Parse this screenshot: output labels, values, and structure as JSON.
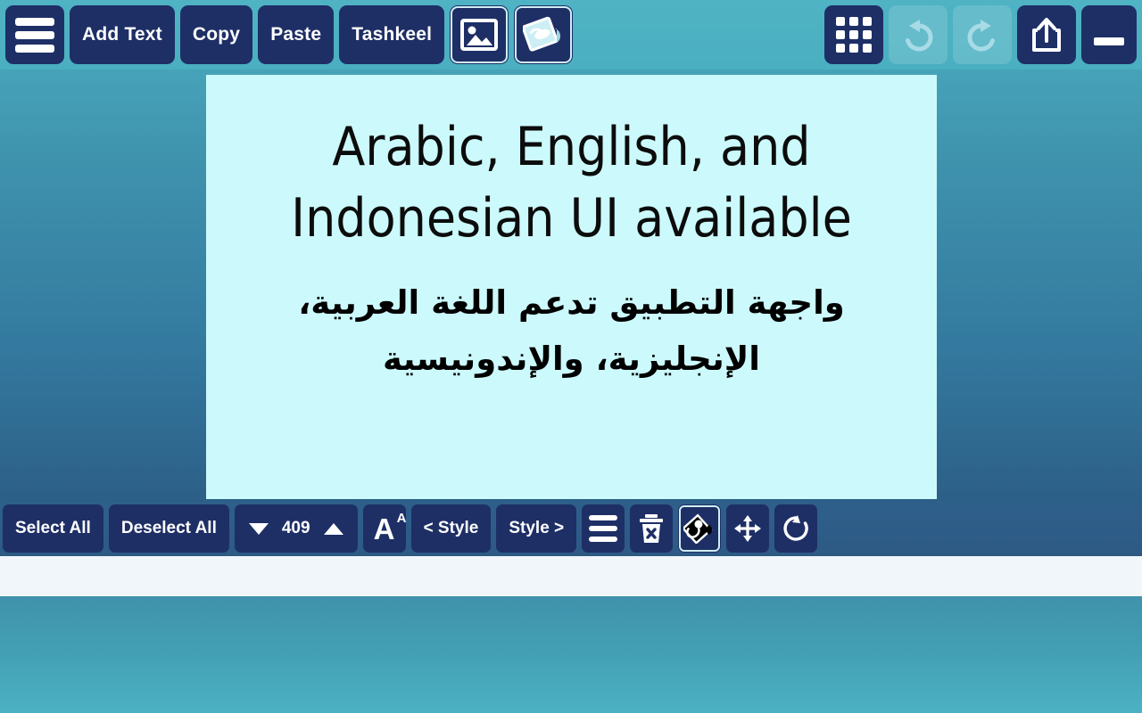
{
  "top_toolbar": {
    "menu_icon": "hamburger-menu-icon",
    "buttons": [
      {
        "label": "Add Text",
        "name": "add-text-button"
      },
      {
        "label": "Copy",
        "name": "copy-button"
      },
      {
        "label": "Paste",
        "name": "paste-button"
      },
      {
        "label": "Tashkeel",
        "name": "tashkeel-button"
      }
    ],
    "image_icon": "image-picture-icon",
    "paste_image_icon": "paste-image-icon",
    "grid_icon": "grid-apps-icon",
    "undo_icon": "undo-icon",
    "redo_icon": "redo-icon",
    "share_icon": "share-export-icon",
    "minimize_icon": "minimize-icon"
  },
  "canvas": {
    "english_line_1": "Arabic, English, and",
    "english_line_2": "Indonesian UI available",
    "arabic_text": "واجهة التطبيق تدعم اللغة العربية، الإنجليزية، والإندونيسية",
    "background_color": "#ccfafc"
  },
  "bottom_toolbar": {
    "select_all_label": "Select All",
    "deselect_all_label": "Deselect All",
    "stepper": {
      "decrement_icon": "triangle-down-icon",
      "value": "409",
      "increment_icon": "triangle-up-icon"
    },
    "font_size_icon": "font-size-icon",
    "font_size_glyph_large": "A",
    "font_size_glyph_small": "A",
    "style_prev_label": "< Style",
    "style_next_label": "Style >",
    "align_icon": "align-lines-icon",
    "delete_icon": "trash-delete-icon",
    "fill_color_icon": "paint-bucket-icon",
    "move_icon": "move-arrows-icon",
    "rotate_icon": "rotate-icon"
  },
  "theme": {
    "accent_dark": "#1e2f66",
    "toolbar_teal": "#4aafc0",
    "bottom_bar": "#2d5a85",
    "strip": "#f1f6fa"
  }
}
